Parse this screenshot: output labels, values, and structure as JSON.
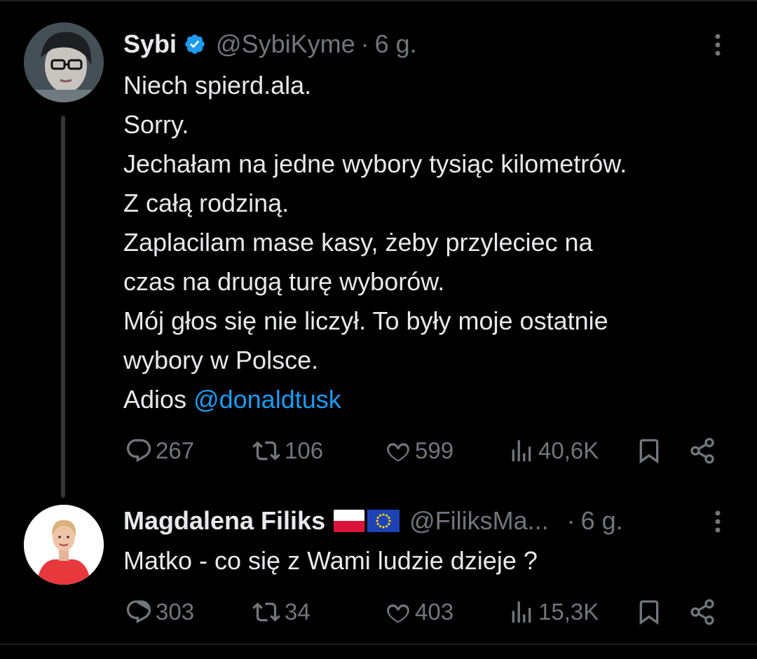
{
  "tweets": [
    {
      "name": "Sybi",
      "handle": "@SybiKyme",
      "separator": "·",
      "time": "6 g.",
      "verified": true,
      "avatar": "avatar-photo-woman-glasses",
      "lines": [
        "Niech spierd.ala.",
        "Sorry.",
        "Jechałam na jedne wybory tysiąc kilometrów.",
        "Z całą rodziną.",
        "Zaplacilam mase kasy, żeby przyleciec na",
        "czas na drugą turę wyborów.",
        "Mój głos się nie liczył. To były moje ostatnie",
        "wybory w Polsce."
      ],
      "last_line_prefix": "Adios ",
      "mention": "@donaldtusk",
      "replies": "267",
      "retweets": "106",
      "likes": "599",
      "views": "40,6K"
    },
    {
      "name": "Magdalena Filiks",
      "handle": "@FiliksMa...",
      "separator": "·",
      "time": "6 g.",
      "flags": [
        "poland-flag-icon",
        "eu-flag-icon"
      ],
      "avatar": "avatar-photo-woman-red-dress",
      "text": "Matko - co się z Wami ludzie dzieje ?",
      "replies": "303",
      "retweets": "34",
      "likes": "403",
      "views": "15,3K"
    }
  ],
  "colors": {
    "background": "#000000",
    "text": "#e7e9ea",
    "muted": "#71767b",
    "link": "#1d9bf0",
    "verified": "#1d9bf0"
  }
}
